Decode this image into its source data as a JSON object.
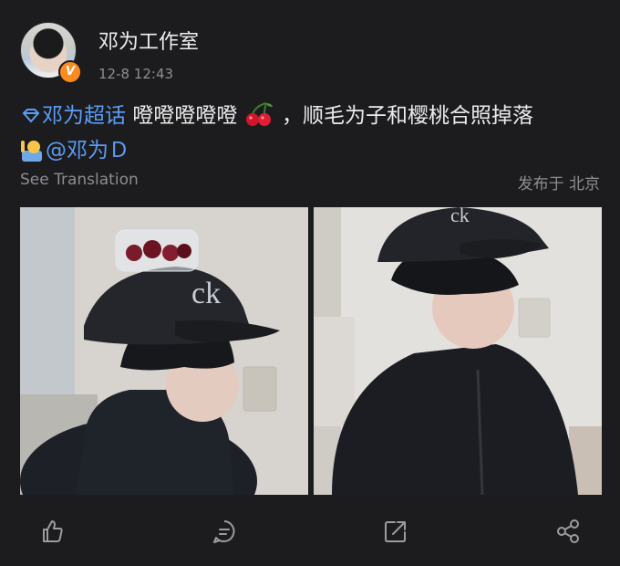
{
  "header": {
    "username": "邓为工作室",
    "time": "12-8 12:43",
    "verified_badge": "V"
  },
  "post": {
    "topic": "邓为超话",
    "text": "噔噔噔噔噔",
    "after_emoji": "，顺毛为子和樱桃合照掉落",
    "mention": "@邓为Ｄ"
  },
  "subline": {
    "translate": "See Translation",
    "location": "发布于 北京"
  },
  "photos": [
    {
      "name": "photo-1",
      "subject": "cherries-on-cap"
    },
    {
      "name": "photo-2",
      "subject": "portrait-in-cap"
    }
  ],
  "actions": [
    {
      "name": "like-icon"
    },
    {
      "name": "comment-icon"
    },
    {
      "name": "repost-icon"
    },
    {
      "name": "share-icon"
    }
  ],
  "colors": {
    "background": "#1c1c1e",
    "link": "#5b9df6",
    "meta": "#8e8e93",
    "badge": "#ff8a1f"
  }
}
